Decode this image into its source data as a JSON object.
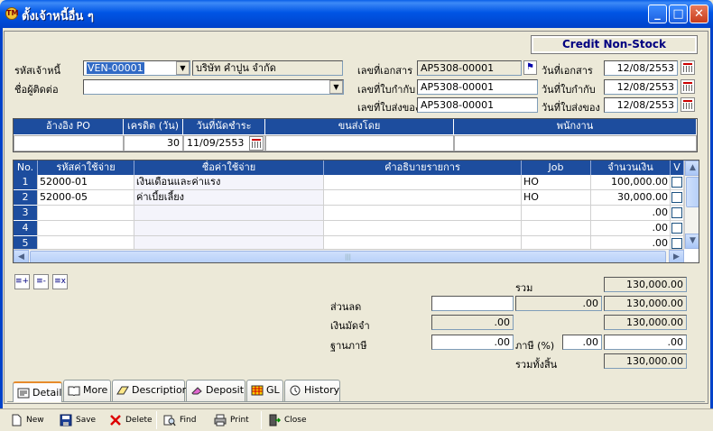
{
  "window": {
    "title": "ตั้งเจ้าหนี้อื่น ๆ",
    "icon_text": "TM",
    "minimize": "_",
    "maximize": "□",
    "close": "✕"
  },
  "mode_badge": "Credit  Non-Stock",
  "form": {
    "creditor_code_label": "รหัสเจ้าหนี้",
    "creditor_code": "VEN-00001",
    "creditor_name": "บริษัท คำปูน จำกัด",
    "contact_label": "ชื่อผู้ติดต่อ",
    "contact": "",
    "doc_no_label": "เลขที่เอกสาร",
    "doc_no": "AP5308-00001",
    "tax_inv_no_label": "เลขที่ใบกำกับ",
    "tax_inv_no": "AP5308-00001",
    "delivery_no_label": "เลขที่ใบส่งของ",
    "delivery_no": "AP5308-00001",
    "doc_date_label": "วันที่เอกสาร",
    "doc_date": "12/08/2553",
    "tax_inv_date_label": "วันที่ใบกำกับ",
    "tax_inv_date": "12/08/2553",
    "delivery_date_label": "วันที่ใบส่งของ",
    "delivery_date": "12/08/2553"
  },
  "po_strip": {
    "headers": [
      "อ้างอิง PO",
      "เครดิต (วัน)",
      "วันที่นัดชำระ",
      "ขนส่งโดย",
      "พนักงาน"
    ],
    "ref_po": "",
    "credit_days": "30",
    "due_date": "11/09/2553",
    "shipped_by": "",
    "employee": ""
  },
  "grid": {
    "columns": [
      "No.",
      "รหัสค่าใช้จ่าย",
      "ชื่อค่าใช้จ่าย",
      "คำอธิบายรายการ",
      "Job",
      "จำนวนเงิน",
      "V"
    ],
    "rows": [
      {
        "no": "1",
        "code": "52000-01",
        "name": "เงินเดือนและค่าแรง",
        "desc": "",
        "job": "HO",
        "amount": "100,000.00"
      },
      {
        "no": "2",
        "code": "52000-05",
        "name": "ค่าเบี้ยเลี้ยง",
        "desc": "",
        "job": "HO",
        "amount": "30,000.00"
      },
      {
        "no": "3",
        "code": "",
        "name": "",
        "desc": "",
        "job": "",
        "amount": ".00"
      },
      {
        "no": "4",
        "code": "",
        "name": "",
        "desc": "",
        "job": "",
        "amount": ".00"
      },
      {
        "no": "5",
        "code": "",
        "name": "",
        "desc": "",
        "job": "",
        "amount": ".00"
      }
    ]
  },
  "row_tools": [
    "≡+",
    "≡-",
    "≡x"
  ],
  "totals": {
    "sum_label": "รวม",
    "sum": "130,000.00",
    "discount_label": "ส่วนลด",
    "discount_text": "",
    "discount_amount": ".00",
    "discount_total": "130,000.00",
    "deposit_label": "เงินมัดจำ",
    "deposit": ".00",
    "after_deposit": "130,000.00",
    "tax_base_label": "ฐานภาษี",
    "tax_base": ".00",
    "tax_rate_label": "ภาษี (%)",
    "tax_rate": ".00",
    "tax_amount": ".00",
    "grand_total_label": "รวมทั้งสิ้น",
    "grand_total": "130,000.00"
  },
  "tabs": [
    "Detail",
    "More",
    "Description",
    "Deposit",
    "GL",
    "History"
  ],
  "toolbar": {
    "new": "New",
    "save": "Save",
    "delete": "Delete",
    "find": "Find",
    "print": "Print",
    "close": "Close"
  }
}
